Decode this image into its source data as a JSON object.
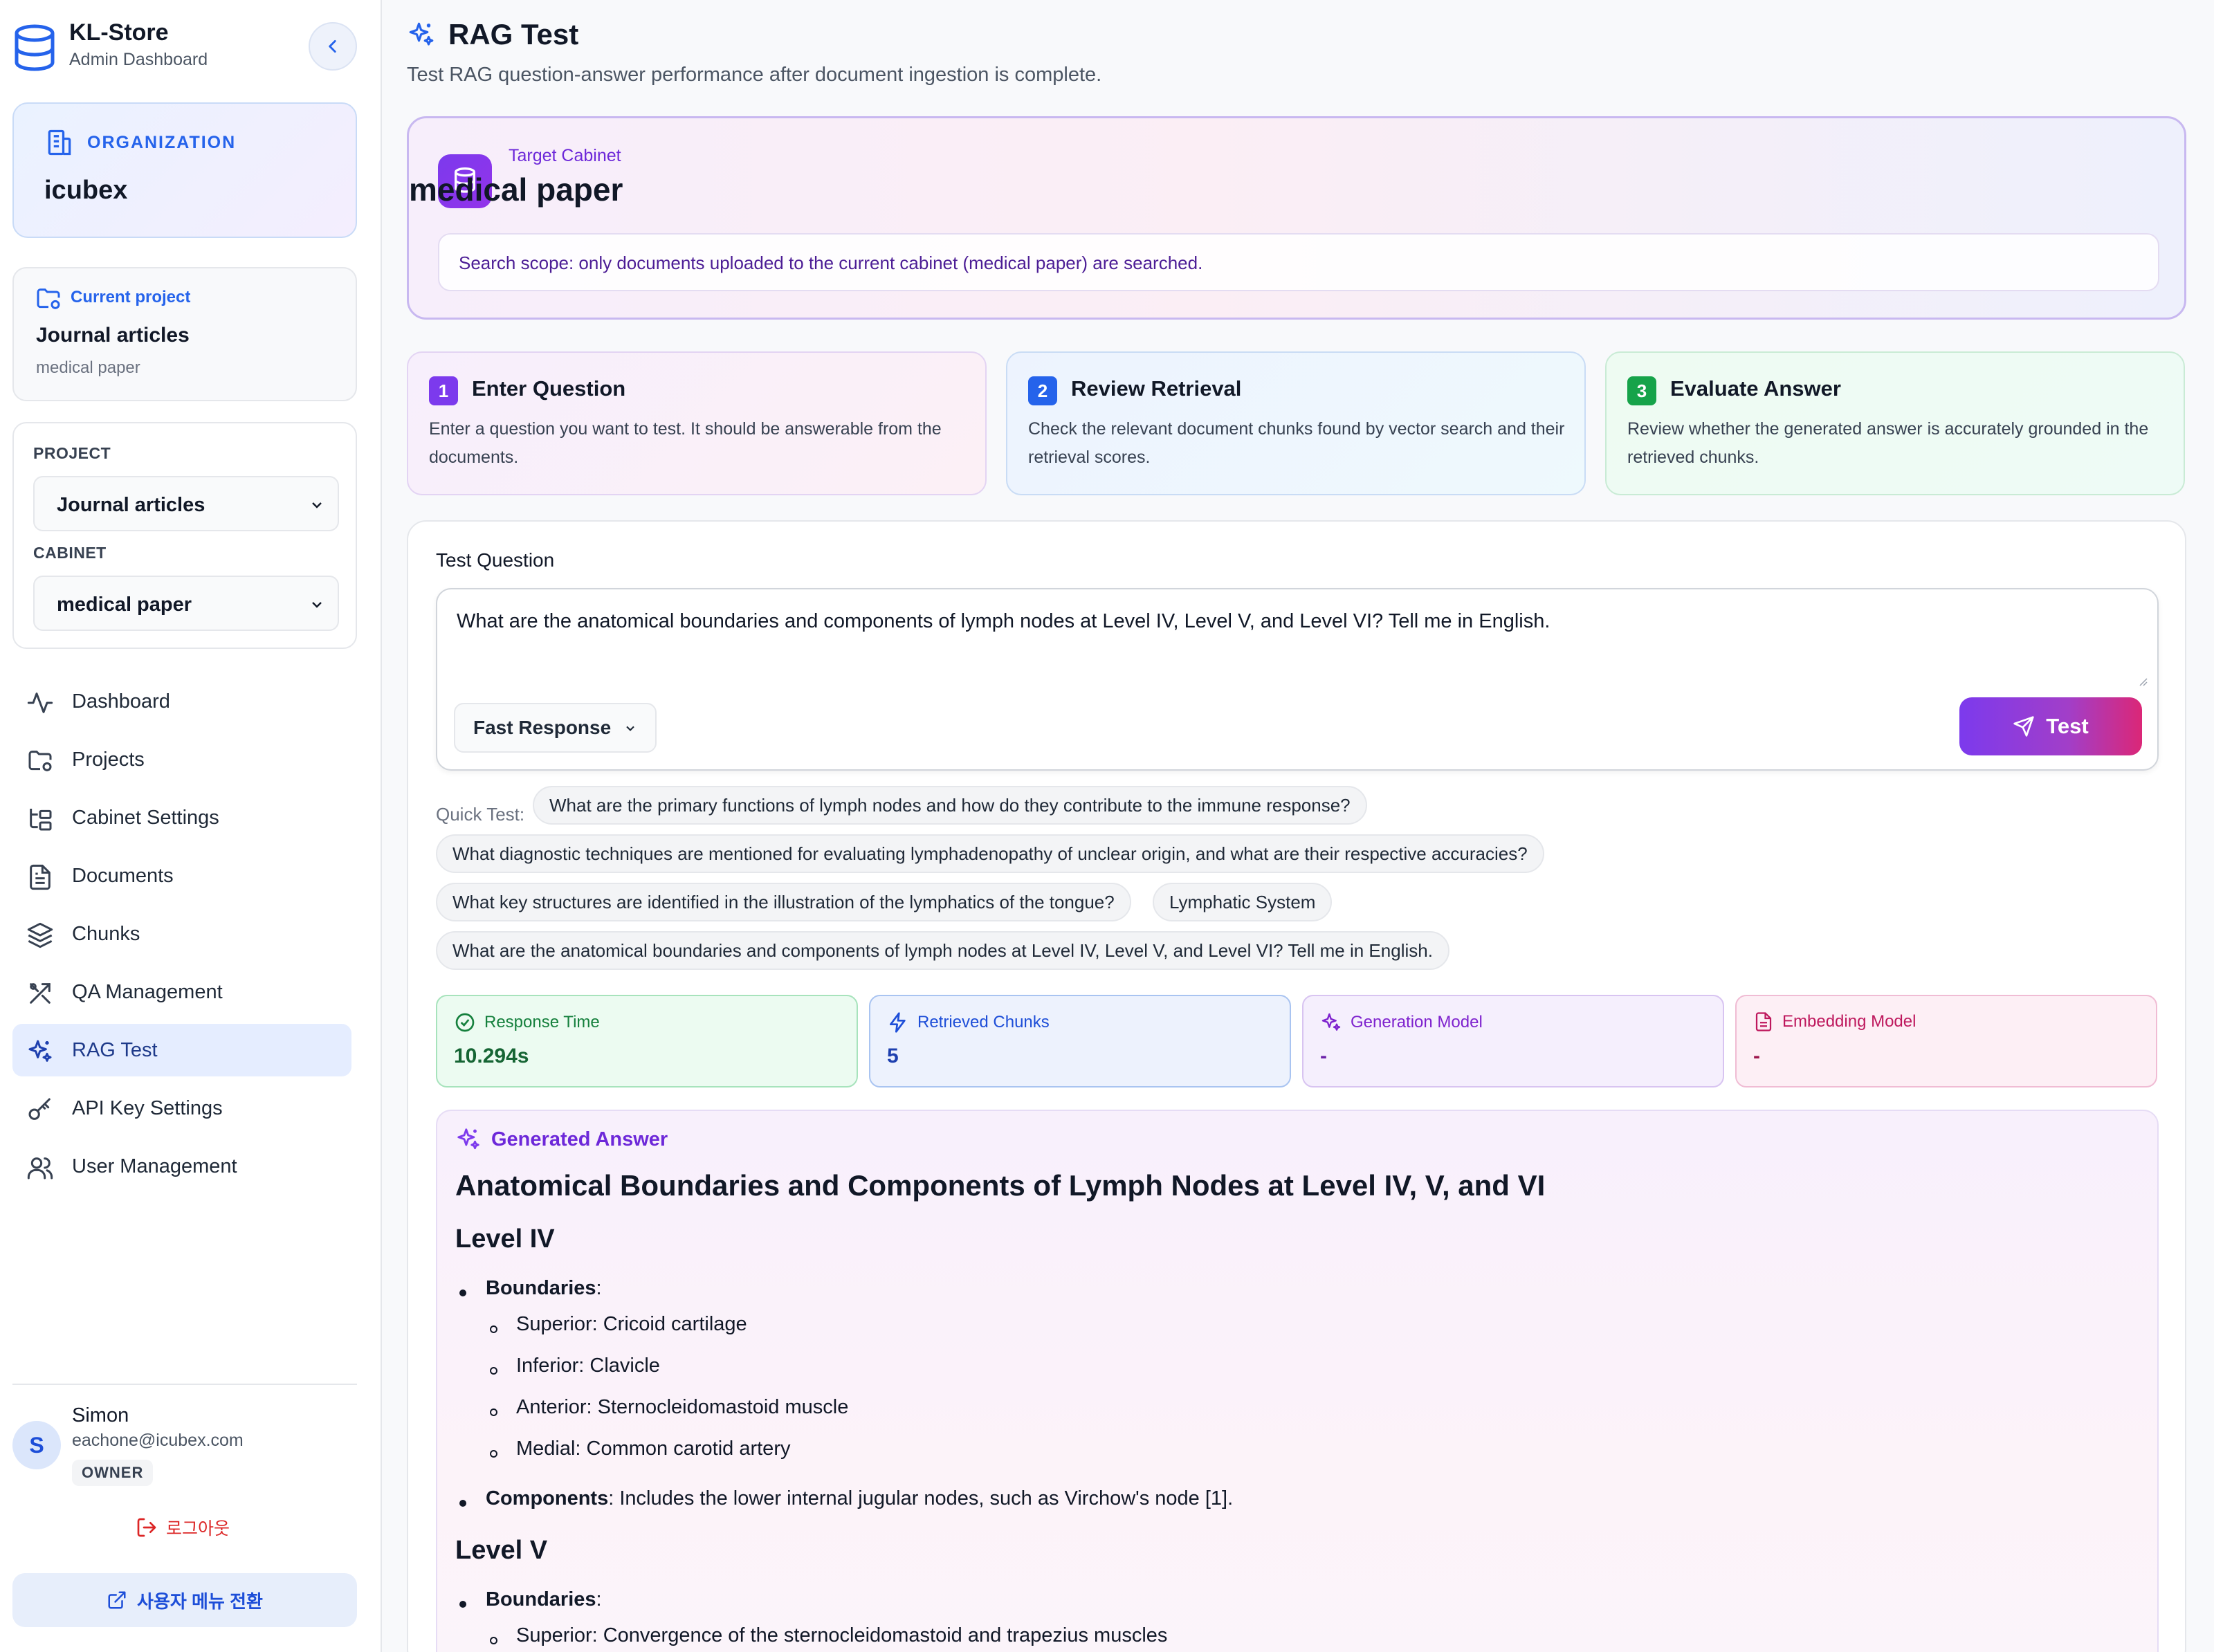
{
  "brand": {
    "title": "KL-Store",
    "subtitle": "Admin Dashboard"
  },
  "organization": {
    "label": "ORGANIZATION",
    "name": "icubex"
  },
  "current_project": {
    "label": "Current project",
    "name": "Journal articles",
    "cabinet": "medical paper"
  },
  "selectors": {
    "project_label": "PROJECT",
    "project_value": "Journal articles",
    "cabinet_label": "CABINET",
    "cabinet_value": "medical paper"
  },
  "nav": {
    "items": [
      {
        "label": "Dashboard",
        "icon": "activity-icon"
      },
      {
        "label": "Projects",
        "icon": "folder-settings-icon"
      },
      {
        "label": "Cabinet Settings",
        "icon": "folder-tree-icon"
      },
      {
        "label": "Documents",
        "icon": "document-icon"
      },
      {
        "label": "Chunks",
        "icon": "layers-icon"
      },
      {
        "label": "QA Management",
        "icon": "tools-icon"
      },
      {
        "label": "RAG Test",
        "icon": "sparkles-icon",
        "active": true
      },
      {
        "label": "API Key Settings",
        "icon": "key-icon"
      },
      {
        "label": "User Management",
        "icon": "users-icon"
      }
    ]
  },
  "user": {
    "initial": "S",
    "name": "Simon",
    "email": "eachone@icubex.com",
    "role": "OWNER"
  },
  "logout_label": "로그아웃",
  "switch_label": "사용자 메뉴 전환",
  "page": {
    "title": "RAG Test",
    "description": "Test RAG question-answer performance after document ingestion is complete."
  },
  "target": {
    "label": "Target Cabinet",
    "name": "medical paper",
    "scope": "Search scope: only documents uploaded to the current cabinet (medical paper) are searched."
  },
  "steps": [
    {
      "num": "1",
      "title": "Enter Question",
      "desc": "Enter a question you want to test. It should be answerable from the documents."
    },
    {
      "num": "2",
      "title": "Review Retrieval",
      "desc": "Check the relevant document chunks found by vector search and their retrieval scores."
    },
    {
      "num": "3",
      "title": "Evaluate Answer",
      "desc": "Review whether the generated answer is accurately grounded in the retrieved chunks."
    }
  ],
  "question": {
    "label": "Test Question",
    "value": "What are the anatomical boundaries and components of lymph nodes at Level IV, Level V, and Level VI? Tell me in English.",
    "mode": "Fast Response",
    "submit": "Test"
  },
  "quick_test": {
    "label": "Quick Test:",
    "chips": [
      "What are the primary functions of lymph nodes and how do they contribute to the immune response?",
      "What diagnostic techniques are mentioned for evaluating lymphadenopathy of unclear origin, and what are their respective accuracies?",
      "What key structures are identified in the illustration of the lymphatics of the tongue?",
      "Lymphatic System",
      "What are the anatomical boundaries and components of lymph nodes at Level IV, Level V, and Level VI? Tell me in English."
    ]
  },
  "metrics": [
    {
      "label": "Response Time",
      "value": "10.294s",
      "icon": "check-circle-icon",
      "color": "#15803d"
    },
    {
      "label": "Retrieved Chunks",
      "value": "5",
      "icon": "zap-icon",
      "color": "#1d4ed8"
    },
    {
      "label": "Generation Model",
      "value": "-",
      "icon": "sparkles-icon",
      "color": "#7e22ce"
    },
    {
      "label": "Embedding Model",
      "value": "-",
      "icon": "document-icon",
      "color": "#be185d"
    }
  ],
  "answer": {
    "label": "Generated Answer",
    "heading": "Anatomical Boundaries and Components of Lymph Nodes at Level IV, V, and VI",
    "level4": {
      "title": "Level IV",
      "boundaries_label": "Boundaries",
      "items": [
        "Superior: Cricoid cartilage",
        "Inferior: Clavicle",
        "Anterior: Sternocleidomastoid muscle",
        "Medial: Common carotid artery"
      ],
      "components_label": "Components",
      "components": ": Includes the lower internal jugular nodes, such as Virchow's node [1]."
    },
    "level5": {
      "title": "Level V",
      "boundaries_label": "Boundaries",
      "items": [
        "Superior: Convergence of the sternocleidomastoid and trapezius muscles"
      ]
    }
  },
  "colors": {
    "accent": "#7c3aed",
    "primary": "#2563eb",
    "danger": "#dc2626"
  }
}
